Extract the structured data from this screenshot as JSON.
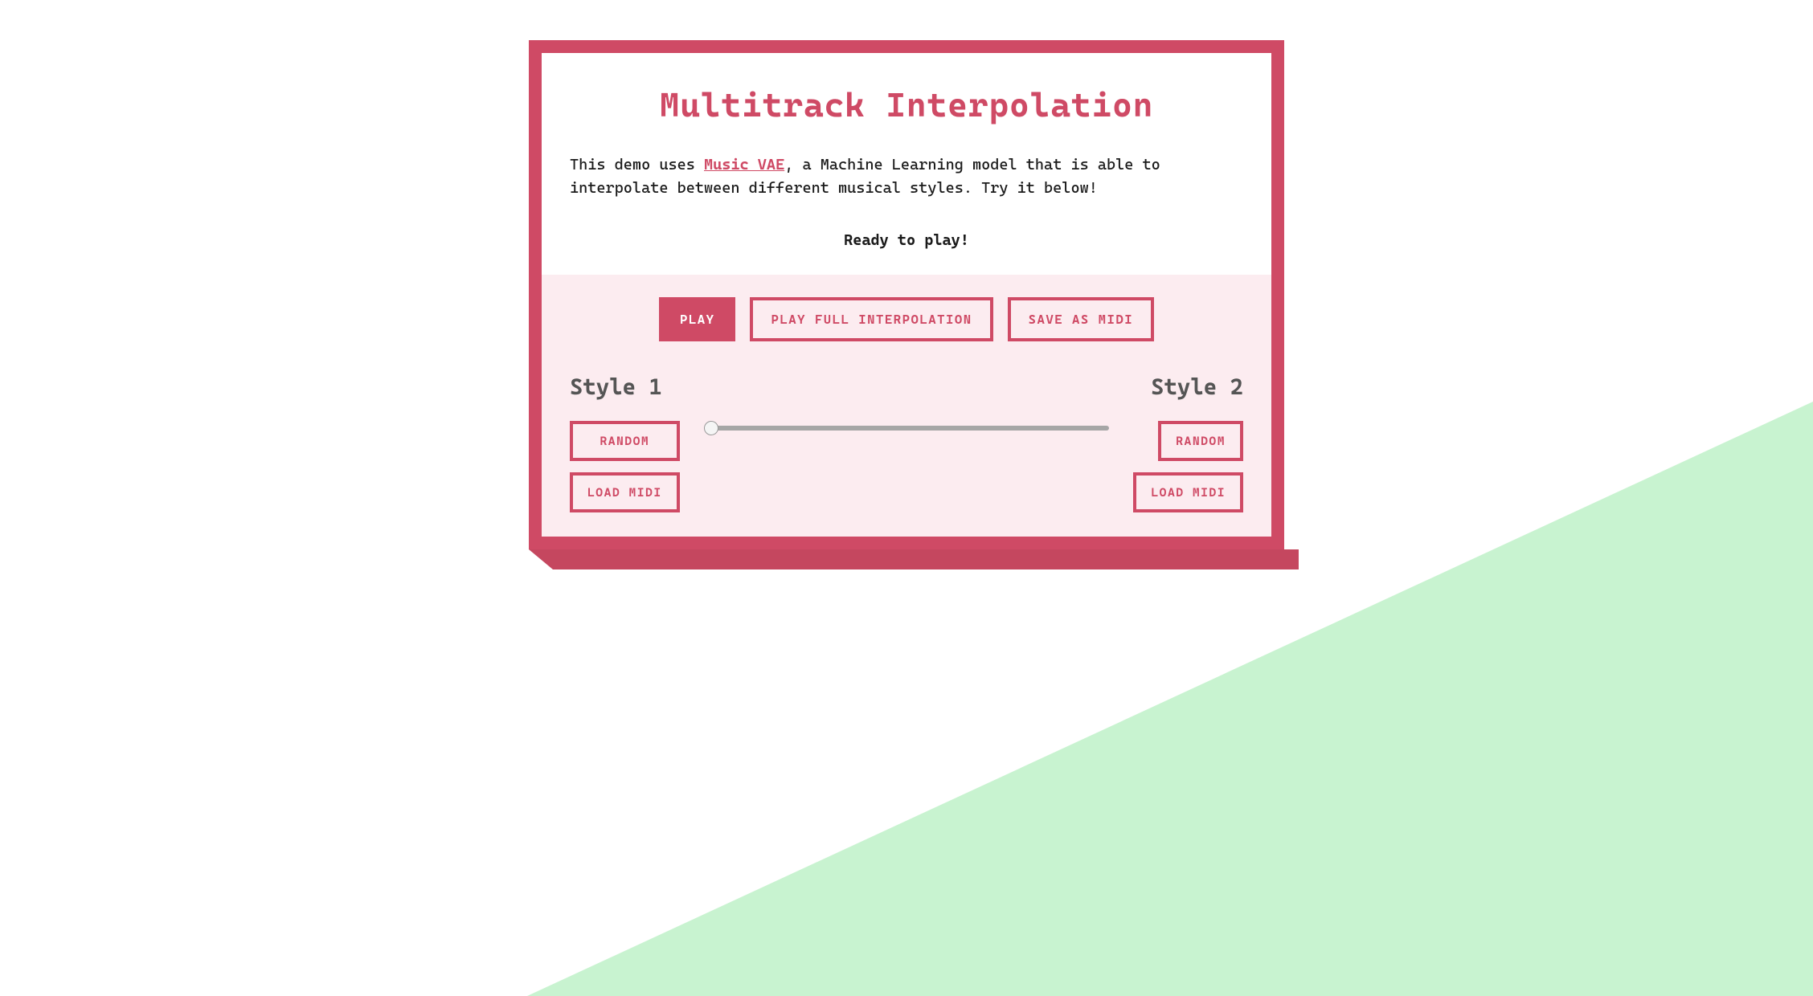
{
  "header": {
    "title": "Multitrack Interpolation",
    "description_before": "This demo uses ",
    "link_text": "Music VAE",
    "description_after": ", a Machine Learning model that is able to interpolate between different musical styles. Try it below!",
    "status": "Ready to play!"
  },
  "controls": {
    "play": "PLAY",
    "play_full": "PLAY FULL INTERPOLATION",
    "save_midi": "SAVE AS MIDI"
  },
  "style1": {
    "label": "Style 1",
    "random": "RANDOM",
    "load_midi": "LOAD MIDI"
  },
  "style2": {
    "label": "Style 2",
    "random": "RANDOM",
    "load_midi": "LOAD MIDI"
  },
  "slider": {
    "min": "0",
    "max": "100",
    "value": "0"
  },
  "colors": {
    "accent": "#cf4a65",
    "accent_shadow": "#c5475f",
    "bg_light": "#fcecf0",
    "bg_triangle": "#c8f3d0"
  }
}
